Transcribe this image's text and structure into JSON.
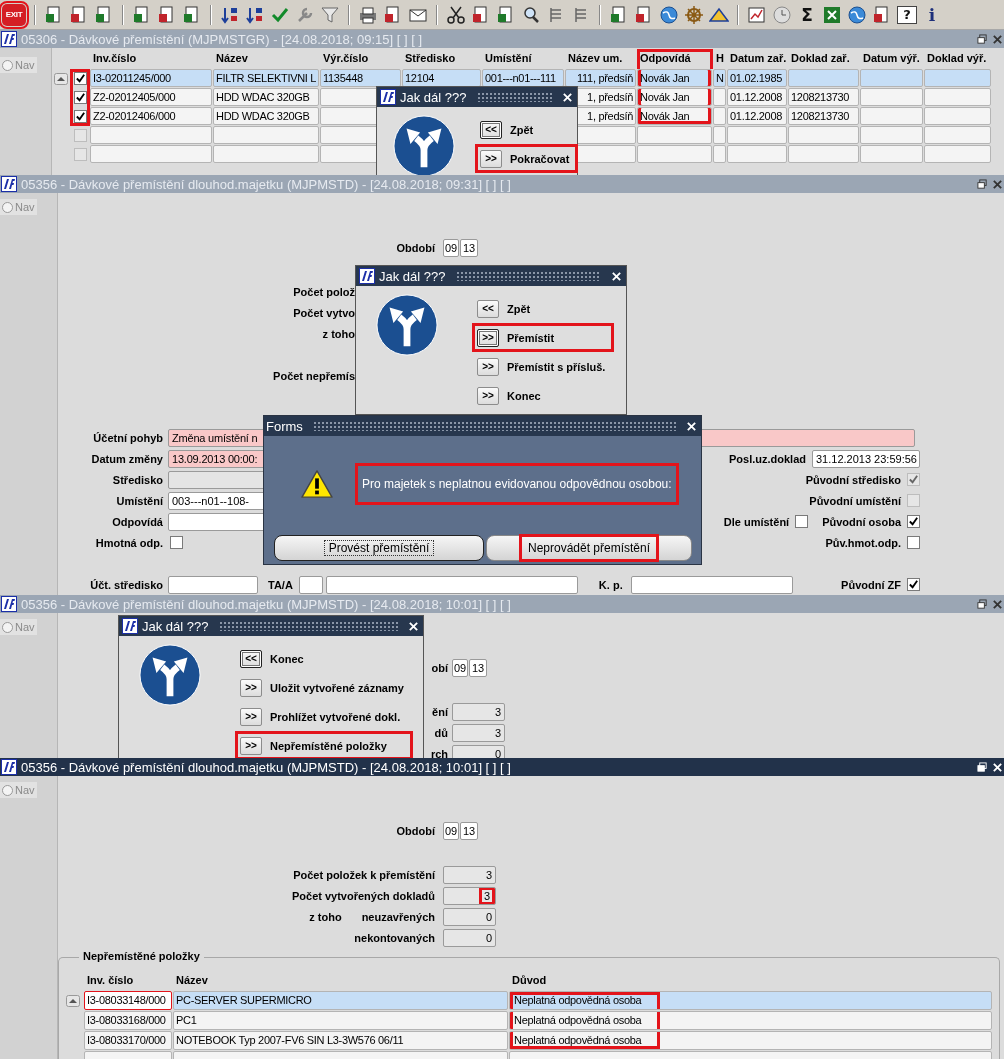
{
  "toolbar": {
    "exit": {
      "label": "EXIT",
      "highlighted": true
    },
    "sum": "Σ",
    "help": "?",
    "info": "i"
  },
  "windows": [
    {
      "kind": "list",
      "active": false,
      "title": "05306 - Dávkové přemístění (MJPMSTGR) - [24.08.2018; 09:15] [ ] [ ]",
      "nav": {
        "label": "Nav",
        "selected": false
      },
      "table": {
        "checkbox_highlighted": true,
        "columns": [
          {
            "label": "Inv.číslo",
            "highlighted": false
          },
          {
            "label": "Název",
            "highlighted": false
          },
          {
            "label": "Výr.číslo",
            "highlighted": false
          },
          {
            "label": "Středisko",
            "highlighted": false
          },
          {
            "label": "Umístění",
            "highlighted": false
          },
          {
            "label": "Název um.",
            "highlighted": false
          },
          {
            "label": "Odpovídá",
            "highlighted": true
          },
          {
            "label": "H",
            "highlighted": false
          },
          {
            "label": "Datum zař.",
            "highlighted": false
          },
          {
            "label": "Doklad zař.",
            "highlighted": false
          },
          {
            "label": "Datum výř.",
            "highlighted": false
          },
          {
            "label": "Doklad výř.",
            "highlighted": false
          }
        ],
        "rows": [
          {
            "checked": true,
            "selected": true,
            "highlighted": true,
            "cells": [
              "I3-02011245/000",
              "FILTR SELEKTIVNI L",
              "1135448",
              "12104",
              "001---n01---111",
              "111, předsíň",
              "Novák Jan",
              "N",
              "01.02.1985",
              null,
              null,
              null
            ]
          },
          {
            "checked": true,
            "selected": false,
            "highlighted": true,
            "cells": [
              "Z2-02012405/000",
              "HDD WDAC 320GB",
              null,
              null,
              null,
              "1, předsíň",
              "Novák Jan",
              null,
              "01.12.2008",
              "1208213730",
              null,
              null
            ]
          },
          {
            "checked": true,
            "selected": false,
            "highlighted": true,
            "cells": [
              "Z2-02012406/000",
              "HDD WDAC 320GB",
              null,
              null,
              null,
              "1, předsíň",
              "Novák Jan",
              null,
              "01.12.2008",
              "1208213730",
              null,
              null
            ]
          },
          {
            "checked": false,
            "selected": false,
            "highlighted": false
          },
          {
            "checked": false,
            "selected": false,
            "highlighted": false
          }
        ]
      },
      "dialog": {
        "title": "Jak dál ???",
        "buttons": [
          {
            "key": "<<",
            "label": "Zpět",
            "focused": true,
            "highlighted": false
          },
          {
            "key": ">>",
            "label": "Pokračovat",
            "focused": false,
            "highlighted": true
          }
        ]
      }
    },
    {
      "kind": "transfer",
      "active": false,
      "title": "05356 - Dávkové přemístění dlouhod.majetku (MJPMSTD) - [24.08.2018; 09:31] [ ] [ ]",
      "nav": {
        "label": "Nav",
        "selected": false
      },
      "period": {
        "label": "Období",
        "month": "09",
        "year": "13"
      },
      "counts": [
        {
          "label": "Počet polož"
        },
        {
          "label": "Počet vytvo"
        },
        {
          "label": "z toho"
        }
      ],
      "pending": {
        "label": "Počet nepřemís"
      },
      "form": {
        "movement": {
          "label": "Účetní pohyb",
          "value": "Změna umístění n"
        },
        "date": {
          "label": "Datum změny",
          "value": "13.09.2013 00:00:"
        },
        "last_doc": {
          "label": "Posl.uz.doklad",
          "value": "31.12.2013 23:59:56"
        },
        "center": {
          "label": "Středisko",
          "disabled": true
        },
        "orig_center": {
          "label": "Původní středisko",
          "checked": true,
          "disabled": true
        },
        "location": {
          "label": "Umístění",
          "value": "003---n01--108-"
        },
        "orig_location": {
          "label": "Původní umístění",
          "checked": false,
          "disabled": true
        },
        "responsible": {
          "label": "Odpovídá"
        },
        "by_location": {
          "label": "Dle umístění",
          "checked": false,
          "disabled": false
        },
        "orig_person": {
          "label": "Původní osoba",
          "checked": true,
          "disabled": false
        },
        "material": {
          "label": "Hmotná odp.",
          "checked": false,
          "disabled": false
        },
        "orig_material": {
          "label": "Pův.hmot.odp.",
          "checked": false,
          "disabled": false
        },
        "acc_center": {
          "label": "Účt. středisko"
        },
        "ta": {
          "label": "TA/A"
        },
        "kp": {
          "label": "K. p."
        },
        "orig_zf": {
          "label": "Původní ZF",
          "checked": true,
          "disabled": false
        }
      },
      "dialog": {
        "title": "Jak dál ???",
        "buttons": [
          {
            "key": "<<",
            "label": "Zpět",
            "focused": false,
            "highlighted": false
          },
          {
            "key": ">>",
            "label": "Přemístit",
            "focused": true,
            "highlighted": true
          },
          {
            "key": ">>",
            "label": "Přemístit s přísluš.",
            "focused": false,
            "highlighted": false
          },
          {
            "key": ">>",
            "label": "Konec",
            "focused": false,
            "highlighted": false
          }
        ]
      },
      "alert": {
        "title": "Forms",
        "message": "Pro majetek s neplatnou evidovanou odpovědnou osobou:",
        "highlighted": true,
        "buttons": [
          {
            "label": "Provést přemístění",
            "focused": true,
            "highlighted": false
          },
          {
            "label": "Neprovádět přemístění",
            "focused": false,
            "highlighted": true
          }
        ]
      }
    },
    {
      "kind": "result",
      "active": false,
      "title": "05356 - Dávkové přemístění dlouhod.majetku (MJPMSTD) - [24.08.2018; 10:01] [ ] [ ]",
      "nav": {
        "label": "Nav",
        "selected": false
      },
      "period": {
        "label": "obí",
        "month": "09",
        "year": "13"
      },
      "counts": [
        {
          "label": "ění",
          "value": "3",
          "highlighted": false
        },
        {
          "label": "dů",
          "value": "3",
          "highlighted": false
        },
        {
          "label": "rch",
          "value": "0",
          "highlighted": false
        }
      ],
      "dialog": {
        "title": "Jak dál ???",
        "buttons": [
          {
            "key": "<<",
            "label": "Konec",
            "focused": true,
            "highlighted": false
          },
          {
            "key": ">>",
            "label": "Uložit vytvořené záznamy",
            "focused": false,
            "highlighted": false
          },
          {
            "key": ">>",
            "label": "Prohlížet vytvořené dokl.",
            "focused": false,
            "highlighted": false
          },
          {
            "key": ">>",
            "label": "Nepřemístěné položky",
            "focused": false,
            "highlighted": true
          }
        ]
      }
    },
    {
      "kind": "summary",
      "active": true,
      "title": "05356 - Dávkové přemístění dlouhod.majetku (MJPMSTD) - [24.08.2018; 10:01] [ ] [ ]",
      "nav": {
        "label": "Nav",
        "selected": false
      },
      "period": {
        "label": "Období",
        "month": "09",
        "year": "13"
      },
      "counts": [
        {
          "label": "Počet položek k přemístění",
          "value": "3",
          "highlighted": false
        },
        {
          "label": "Počet vytvořených dokladů",
          "value": "3",
          "highlighted": true
        },
        {
          "prefix": "z toho",
          "label": "neuzavřených",
          "value": "0",
          "highlighted": false
        },
        {
          "label": "nekontovaných",
          "value": "0",
          "highlighted": false
        }
      ],
      "group": {
        "title": "Nepřemístěné položky",
        "columns": [
          "Inv. číslo",
          "Název",
          "Důvod"
        ],
        "rows": [
          {
            "selected": true,
            "highlighted": true,
            "cells": [
              "I3-08033148/000",
              "PC-SERVER SUPERMICRO",
              "Neplatná odpovědná osoba"
            ]
          },
          {
            "selected": false,
            "highlighted": true,
            "cells": [
              "I3-08033168/000",
              "PC1",
              "Neplatná odpovědná osoba"
            ]
          },
          {
            "selected": false,
            "highlighted": true,
            "cells": [
              "I3-08033170/000",
              "NOTEBOOK Typ 2007-FV6 SIN L3-3W576 06/11",
              "Neplatná odpovědná osoba"
            ]
          },
          {
            "selected": false,
            "highlighted": false
          }
        ]
      }
    }
  ]
}
